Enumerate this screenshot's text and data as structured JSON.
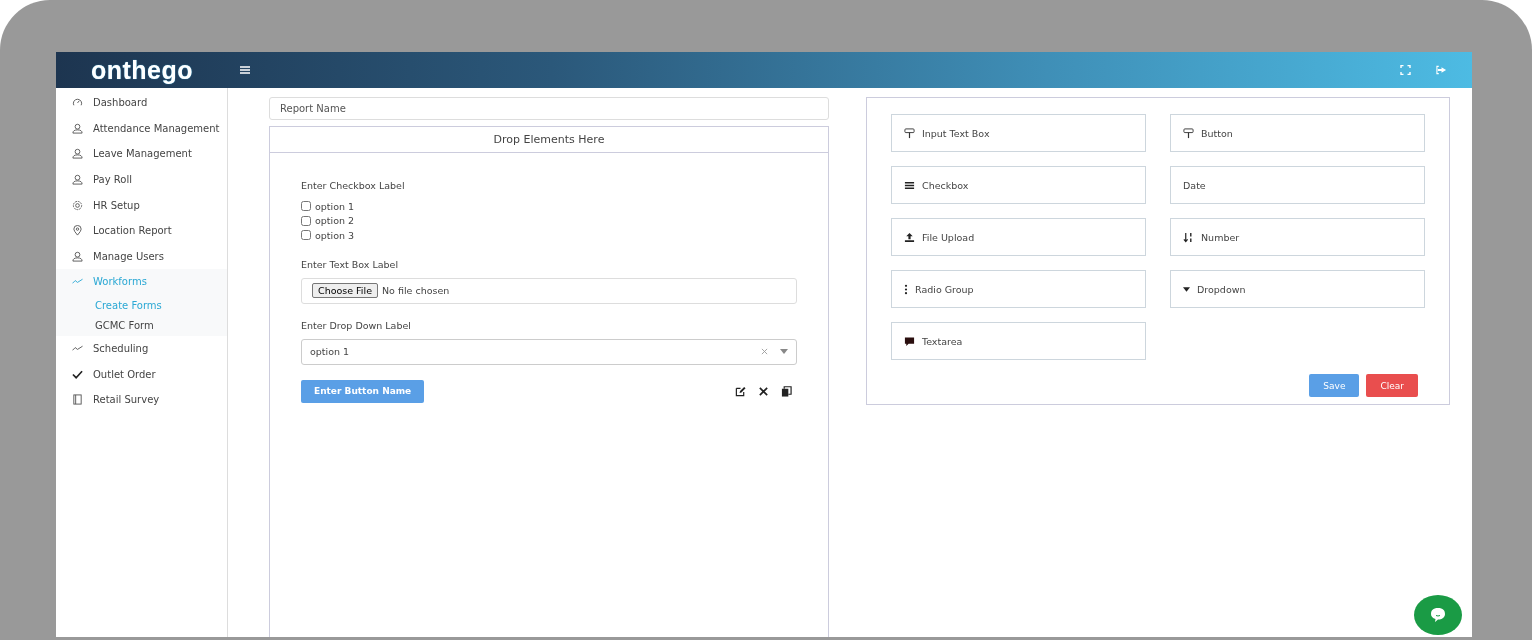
{
  "topbar": {
    "logo": "onthego"
  },
  "sidebar": {
    "items": [
      {
        "label": "Dashboard",
        "kind": "gauge",
        "selected": false
      },
      {
        "label": "Attendance Management",
        "kind": "user",
        "selected": false
      },
      {
        "label": "Leave Management",
        "kind": "user",
        "selected": false
      },
      {
        "label": "Pay Roll",
        "kind": "user",
        "selected": false
      },
      {
        "label": "HR Setup",
        "kind": "gear",
        "selected": false
      },
      {
        "label": "Location Report",
        "kind": "pin",
        "selected": false
      },
      {
        "label": "Manage Users",
        "kind": "user",
        "selected": false
      },
      {
        "label": "Workforms",
        "kind": "trend",
        "selected": true,
        "children": [
          {
            "label": "Create Forms",
            "selected": true
          },
          {
            "label": "GCMC Form",
            "selected": false
          }
        ]
      },
      {
        "label": "Scheduling",
        "kind": "trend",
        "selected": false
      },
      {
        "label": "Outlet Order",
        "kind": "check",
        "selected": false
      },
      {
        "label": "Retail Survey",
        "kind": "book",
        "selected": false
      }
    ]
  },
  "report_name": {
    "placeholder": "Report Name"
  },
  "drop_zone": {
    "title": "Drop Elements Here",
    "fields": [
      {
        "kind": "checkbox",
        "label": "Enter Checkbox Label",
        "options": [
          {
            "label": "option 1",
            "checked": false
          },
          {
            "label": "option 2",
            "checked": false
          },
          {
            "label": "option 3",
            "checked": false
          }
        ]
      },
      {
        "kind": "file",
        "label": "Enter Text Box Label",
        "button": "Choose File",
        "value": "No file chosen"
      },
      {
        "kind": "select",
        "label": "Enter Drop Down Label",
        "value": "option 1"
      },
      {
        "kind": "button",
        "label": "Enter Button Name"
      }
    ]
  },
  "palette": {
    "items": [
      {
        "label": "Input Text Box",
        "kind": "text"
      },
      {
        "label": "Button",
        "kind": "button"
      },
      {
        "label": "Checkbox",
        "kind": "checkbox"
      },
      {
        "label": "Date",
        "kind": "date"
      },
      {
        "label": "File Upload",
        "kind": "file"
      },
      {
        "label": "Number",
        "kind": "number"
      },
      {
        "label": "Radio Group",
        "kind": "radio"
      },
      {
        "label": "Dropdown",
        "kind": "dropdown"
      },
      {
        "label": "Textarea",
        "kind": "textarea"
      }
    ],
    "buttons": [
      {
        "label": "Save",
        "kind": "primary"
      },
      {
        "label": "Clear",
        "kind": "danger"
      }
    ]
  }
}
